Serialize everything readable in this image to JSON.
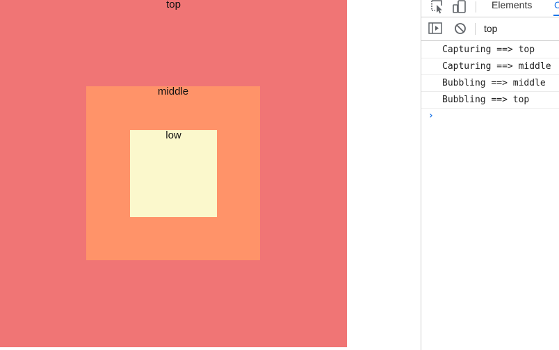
{
  "page": {
    "top_label": "top",
    "middle_label": "middle",
    "low_label": "low"
  },
  "devtools": {
    "tabs": [
      {
        "label": "Elements"
      },
      {
        "label": "C"
      }
    ],
    "toolbar": {
      "context": "top"
    },
    "console": {
      "messages": [
        "Capturing ==> top",
        "Capturing ==> middle",
        "Bubbling ==> middle",
        "Bubbling ==> top"
      ],
      "prompt": "›"
    }
  },
  "colors": {
    "top": "#f07575",
    "middle": "#ff9369",
    "low": "#fbf8cc",
    "accent": "#1a73e8"
  },
  "icons": [
    "inspect-element-icon",
    "device-toolbar-icon",
    "console-sidebar-icon",
    "clear-console-icon",
    "console-prompt-icon"
  ]
}
